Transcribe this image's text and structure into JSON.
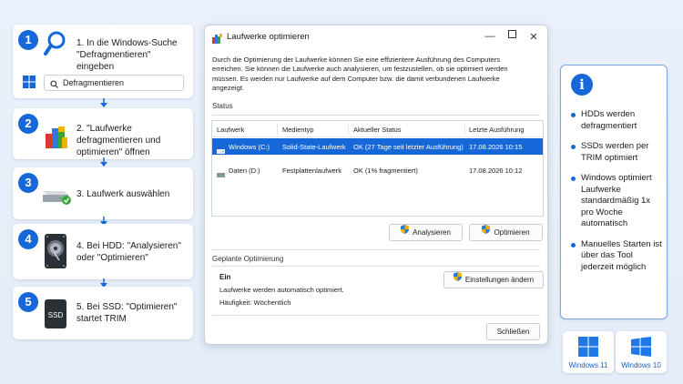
{
  "steps": [
    {
      "number": "1",
      "text": "1. In die Windows-Suche \"Defragmentieren\" eingeben",
      "search_value": "Defragmentieren"
    },
    {
      "number": "2",
      "text": "2. \"Laufwerke defragmentieren und optimieren\" öffnen"
    },
    {
      "number": "3",
      "text": "3. Laufwerk auswählen"
    },
    {
      "number": "4",
      "text": "4. Bei HDD: \"Analysieren\" oder \"Optimieren\""
    },
    {
      "number": "5",
      "text": "5. Bei SSD: \"Optimieren\" startet TRIM",
      "ssd_label": "SSD"
    }
  ],
  "window": {
    "title": "Laufwerke optimieren",
    "description": "Durch die Optimierung der Laufwerke können Sie eine effizientere Ausführung des Computers erreichen. Sie können die Laufwerke auch analysieren, um festzustellen, ob sie optimiert werden müssen. Es werden nur Laufwerke auf dem Computer bzw. die damit verbundenen Laufwerke angezeigt.",
    "status_label": "Status",
    "columns": [
      "Laufwerk",
      "Medientyp",
      "Aktueller Status",
      "Letzte Ausführung"
    ],
    "drives": [
      {
        "name": "Windows (C:)",
        "media": "Solid-State-Laufwerk",
        "status": "OK (27 Tage seit letzter Ausführung)",
        "last_run": "17.08.2026 10:15",
        "selected": true
      },
      {
        "name": "Daten (D:)",
        "media": "Festplattenlaufwerk",
        "status": "OK (1% fragmentiert)",
        "last_run": "17.08.2026 10:12",
        "selected": false
      }
    ],
    "analyze_label": "Analysieren",
    "optimize_label": "Optimieren",
    "scheduled_label": "Geplante Optimierung",
    "scheduled_state": "Ein",
    "scheduled_desc": "Laufwerke werden automatisch optimiert.",
    "frequency": "Häufigkeit: Wöchentlich",
    "change_settings_label": "Einstellungen ändern",
    "close_label": "Schließen"
  },
  "info": {
    "icon": "i",
    "items": [
      "HDDs werden defragmentiert",
      "SSDs werden per TRIM optimiert",
      "Windows optimiert Laufwerke standardmäßig 1x pro Woche automatisch",
      "Manuelles Starten ist über das Tool jederzeit möglich"
    ]
  },
  "os_badges": [
    "Windows 11",
    "Windows 10"
  ],
  "colors": {
    "accent": "#1668d8",
    "background": "#e7eef9"
  }
}
